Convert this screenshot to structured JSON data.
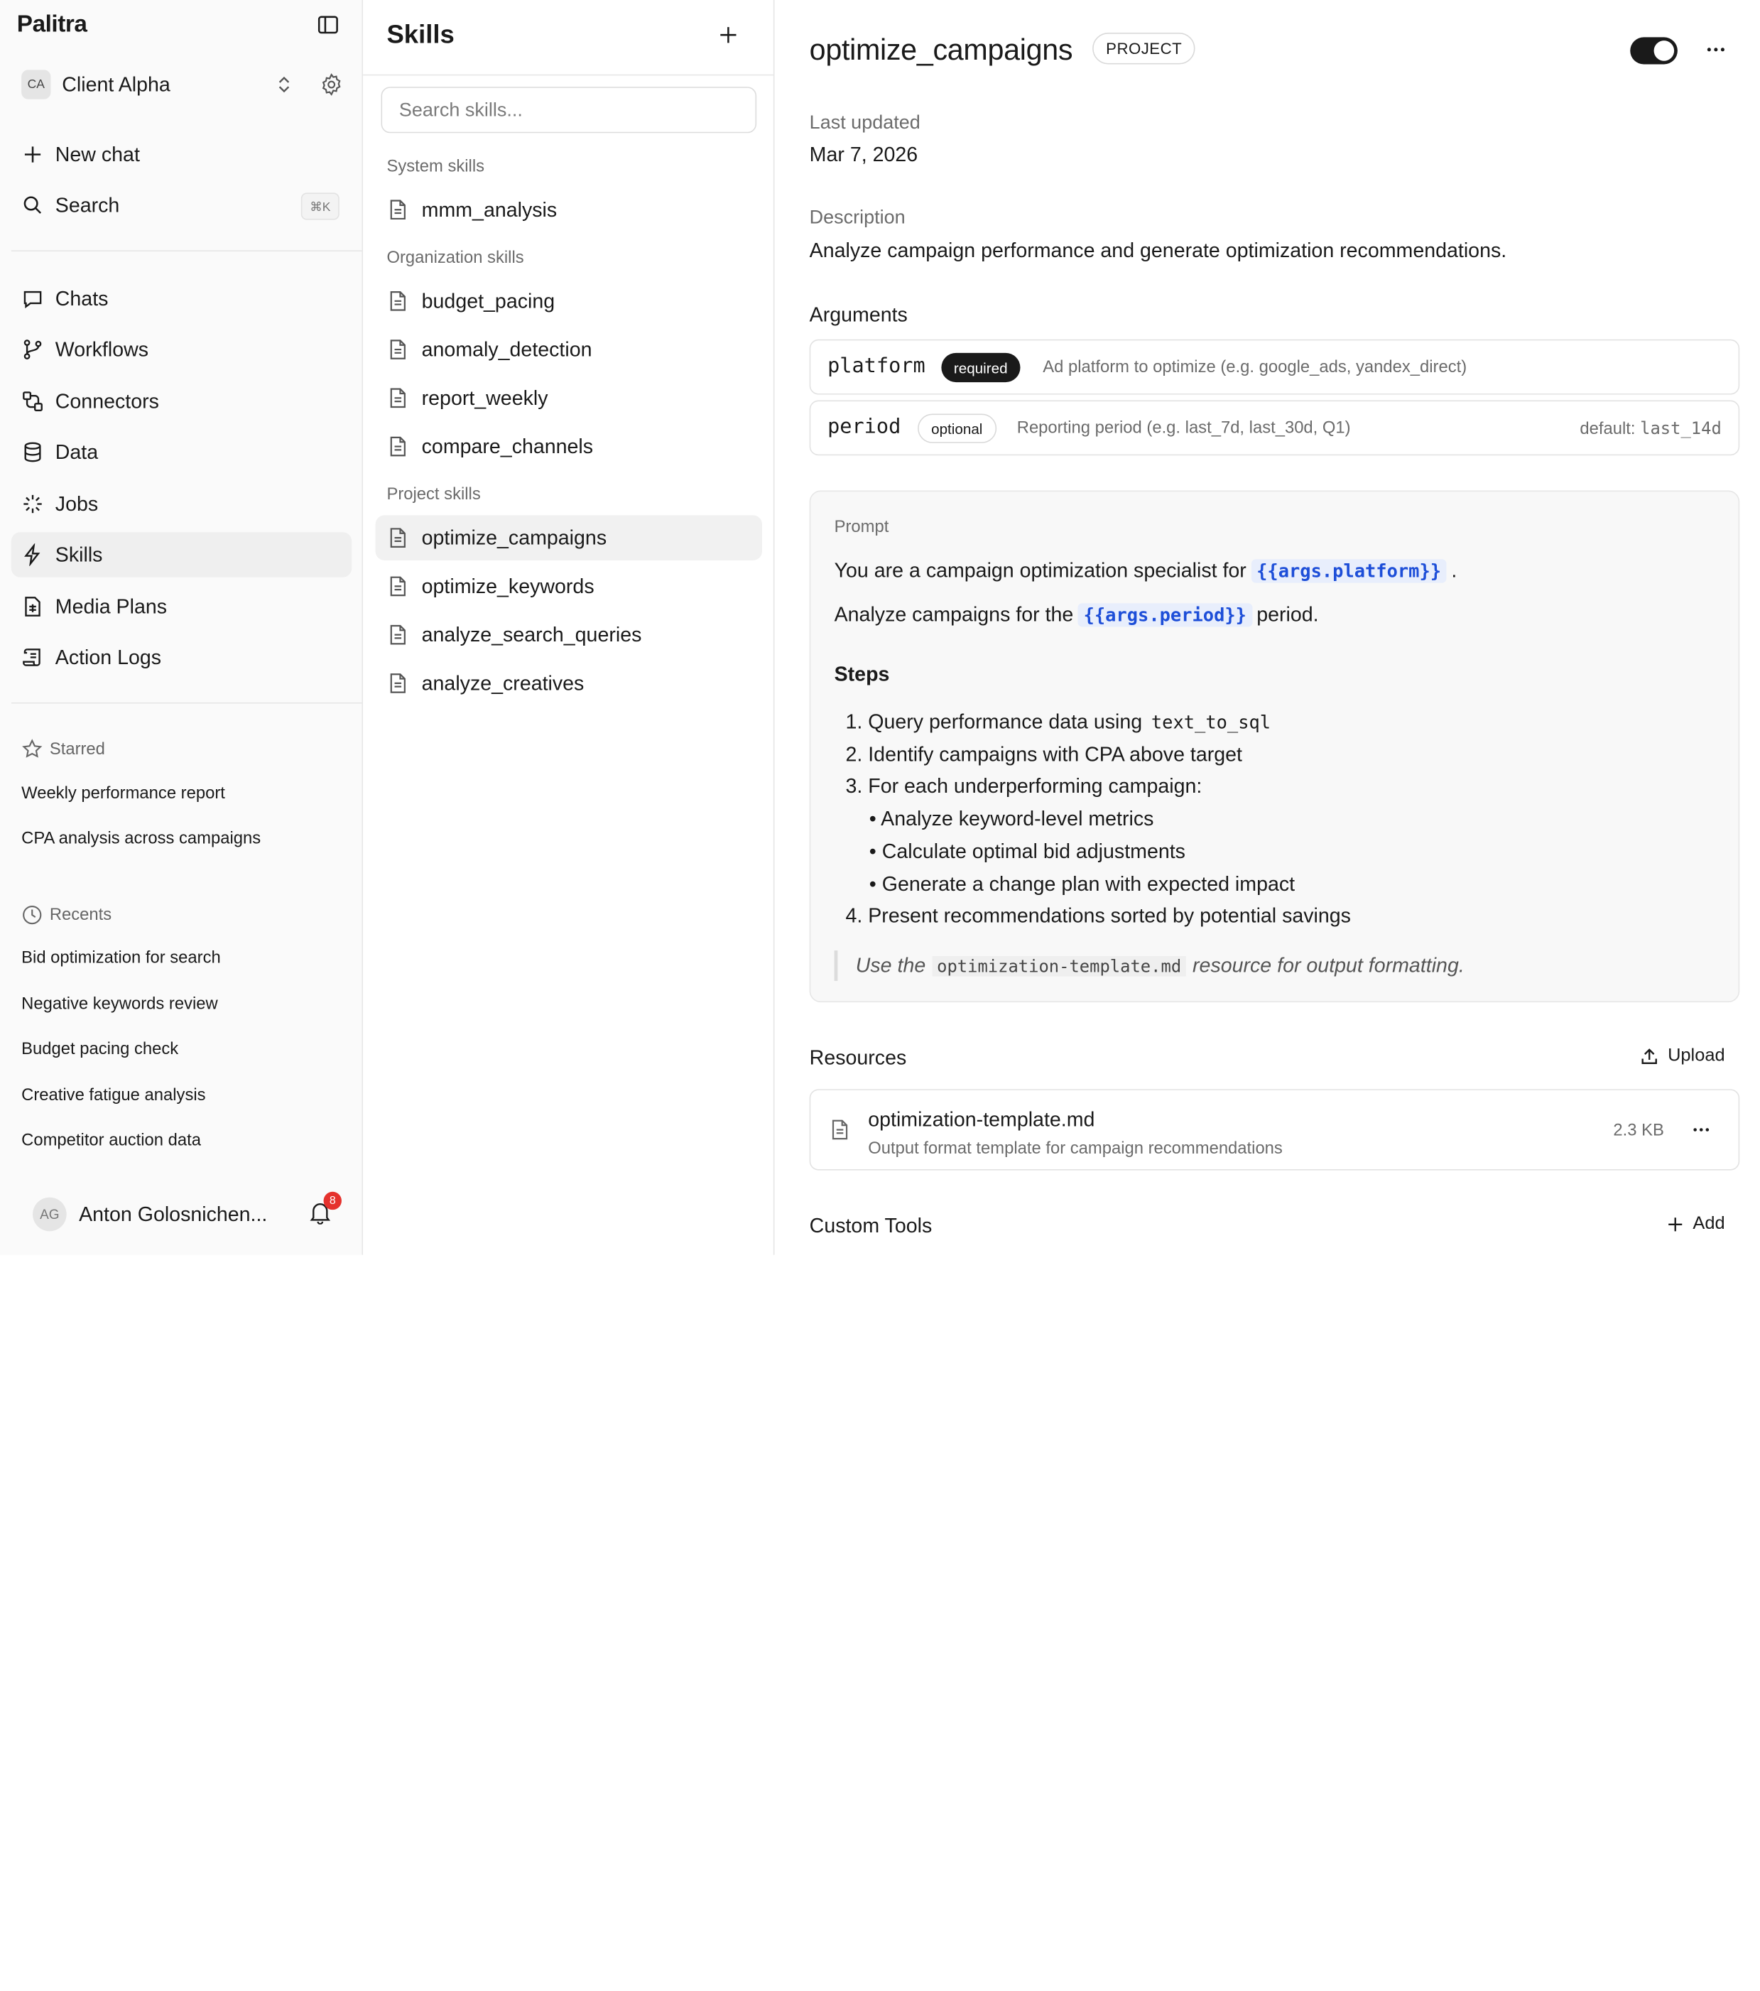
{
  "app": {
    "name": "Palitra"
  },
  "workspace": {
    "initials": "CA",
    "name": "Client Alpha"
  },
  "top_nav": {
    "new_chat": "New chat",
    "search": "Search",
    "search_shortcut": "⌘K"
  },
  "nav": {
    "chats": "Chats",
    "workflows": "Workflows",
    "connectors": "Connectors",
    "data": "Data",
    "jobs": "Jobs",
    "skills": "Skills",
    "media_plans": "Media Plans",
    "action_logs": "Action Logs"
  },
  "starred": {
    "title": "Starred",
    "items": [
      "Weekly performance report",
      "CPA analysis across campaigns"
    ]
  },
  "recents": {
    "title": "Recents",
    "items": [
      "Bid optimization for search",
      "Negative keywords review",
      "Budget pacing check",
      "Creative fatigue analysis",
      "Competitor auction data"
    ]
  },
  "user": {
    "initials": "AG",
    "name": "Anton Golosnichen...",
    "notifications": "8"
  },
  "skills_panel": {
    "title": "Skills",
    "search_placeholder": "Search skills...",
    "system_label": "System skills",
    "system": [
      "mmm_analysis"
    ],
    "org_label": "Organization skills",
    "org": [
      "budget_pacing",
      "anomaly_detection",
      "report_weekly",
      "compare_channels"
    ],
    "project_label": "Project skills",
    "project": [
      "optimize_campaigns",
      "optimize_keywords",
      "analyze_search_queries",
      "analyze_creatives"
    ]
  },
  "detail": {
    "title": "optimize_campaigns",
    "scope": "PROJECT",
    "enabled": true,
    "last_updated_label": "Last updated",
    "last_updated": "Mar 7, 2026",
    "description_label": "Description",
    "description": "Analyze campaign performance and generate optimization recommendations.",
    "arguments_label": "Arguments",
    "arguments": [
      {
        "name": "platform",
        "flag": "required",
        "desc": "Ad platform to optimize (e.g. google_ads, yandex_direct)",
        "default": ""
      },
      {
        "name": "period",
        "flag": "optional",
        "desc": "Reporting period (e.g. last_7d, last_30d, Q1)",
        "default_label": "default:",
        "default": "last_14d"
      }
    ],
    "prompt": {
      "label": "Prompt",
      "line1_pre": "You are a campaign optimization specialist for",
      "line1_var": "{{args.platform}}",
      "line1_post": ".",
      "line2_pre": "Analyze campaigns for the",
      "line2_var": "{{args.period}}",
      "line2_post": "period.",
      "steps_title": "Steps",
      "step1": "1. Query performance data using",
      "step1_code": "text_to_sql",
      "step2": "2. Identify campaigns with CPA above target",
      "step3": "3. For each underperforming campaign:",
      "sub1": "• Analyze keyword-level metrics",
      "sub2": "• Calculate optimal bid adjustments",
      "sub3": "• Generate a change plan with expected impact",
      "step4": "4. Present recommendations sorted by potential savings",
      "note_pre": "Use the",
      "note_code": "optimization-template.md",
      "note_post": "resource for output formatting."
    },
    "resources_label": "Resources",
    "upload_label": "Upload",
    "resource": {
      "name": "optimization-template.md",
      "desc": "Output format template for campaign recommendations",
      "size": "2.3 KB"
    },
    "custom_tools_label": "Custom Tools",
    "add_label": "Add"
  }
}
